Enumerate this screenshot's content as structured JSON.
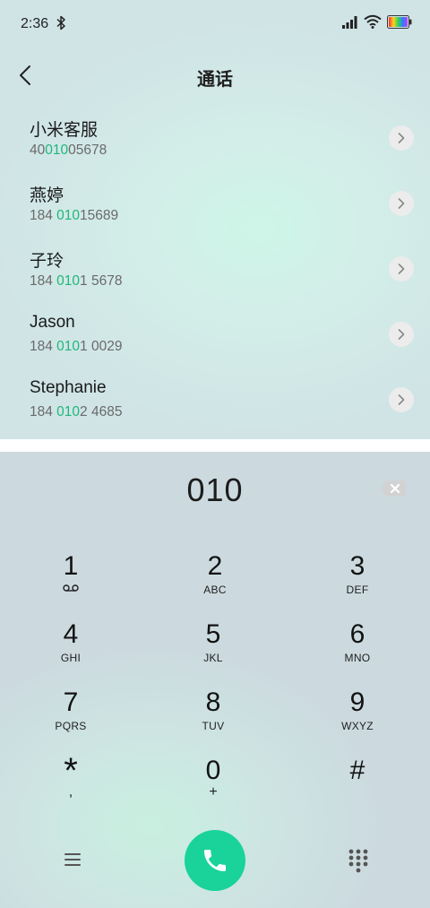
{
  "status_bar": {
    "time": "2:36",
    "icons": [
      "bluetooth-icon",
      "signal-icon",
      "wifi-icon",
      "battery-icon"
    ]
  },
  "header": {
    "title": "通话",
    "back_icon": "chevron-left-icon"
  },
  "contacts": [
    {
      "name": "小米客服",
      "number_pre": "40",
      "number_match": "010",
      "number_post": "05678"
    },
    {
      "name": "燕婷",
      "number_pre": "184 ",
      "number_match": "010",
      "number_post": "15689"
    },
    {
      "name": "子玲",
      "number_pre": "184 ",
      "number_match": "010",
      "number_post": "1 5678"
    },
    {
      "name": "Jason",
      "number_pre": "184 ",
      "number_match": "010",
      "number_post": "1 0029"
    },
    {
      "name": "Stephanie",
      "number_pre": "184 ",
      "number_match": "010",
      "number_post": "2 4685"
    }
  ],
  "dialer": {
    "display": "010",
    "keys": [
      {
        "digit": "1",
        "letters": ""
      },
      {
        "digit": "2",
        "letters": "ABC"
      },
      {
        "digit": "3",
        "letters": "DEF"
      },
      {
        "digit": "4",
        "letters": "GHI"
      },
      {
        "digit": "5",
        "letters": "JKL"
      },
      {
        "digit": "6",
        "letters": "MNO"
      },
      {
        "digit": "7",
        "letters": "PQRS"
      },
      {
        "digit": "8",
        "letters": "TUV"
      },
      {
        "digit": "9",
        "letters": "WXYZ"
      },
      {
        "digit": "*",
        "letters": ","
      },
      {
        "digit": "0",
        "letters": "+"
      },
      {
        "digit": "#",
        "letters": ""
      }
    ]
  },
  "colors": {
    "match_highlight": "#21b77a",
    "call_button": "#19d39a"
  }
}
